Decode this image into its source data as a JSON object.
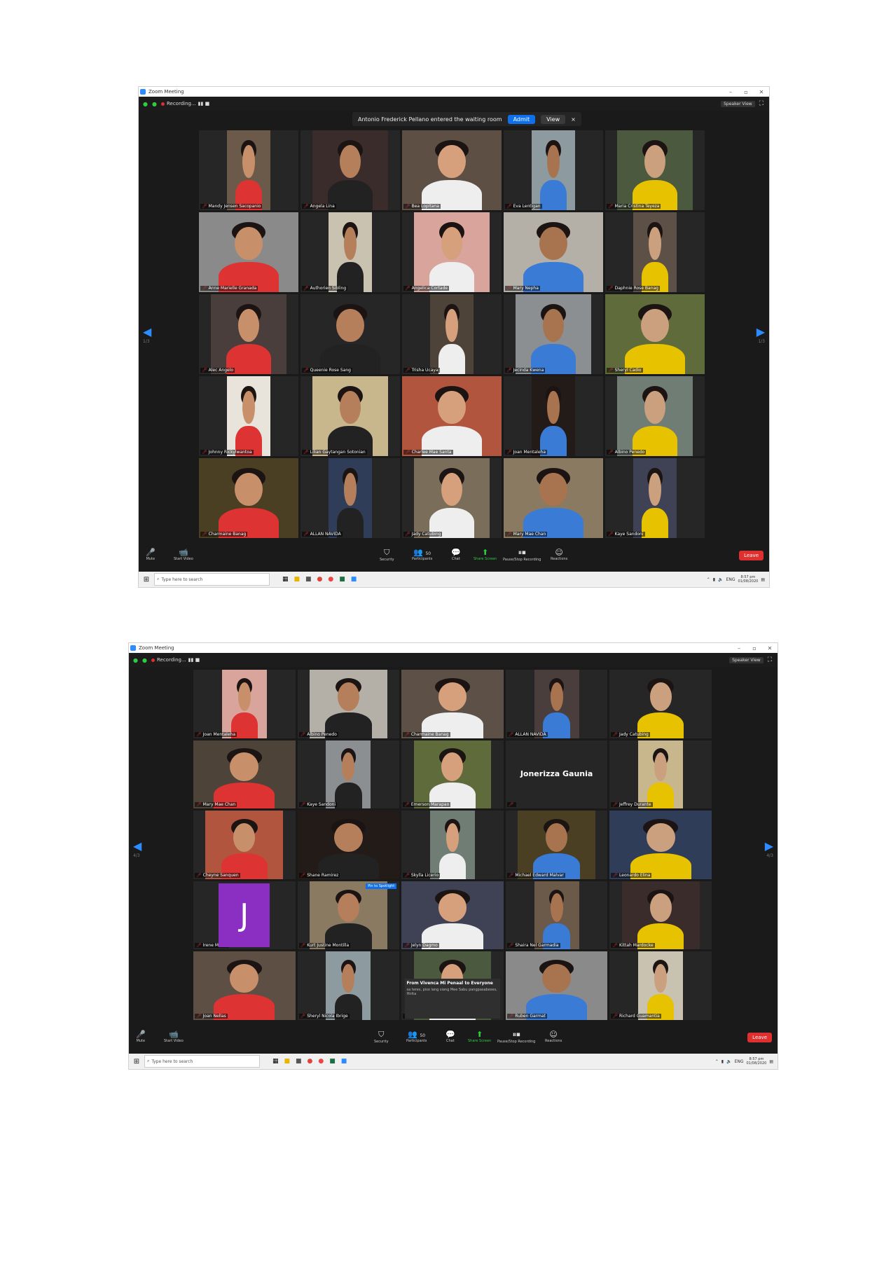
{
  "screens": [
    {
      "window_title": "Zoom Meeting",
      "recording_label": "Recording...",
      "notice": {
        "text": "Antonio Frederick Pellano entered the waiting room",
        "admit": "Admit",
        "view": "View",
        "close": "×"
      },
      "speaker_view": "Speaker View",
      "page_left": "1/3",
      "page_right": "1/3",
      "participants": [
        "Mandy Jensen Sacopanio",
        "Angela Lina",
        "Bea Lopitana",
        "Eva Lentigan",
        "Maria Cristina Teyeza",
        "Anne Marielle Granada",
        "Authorien Sibling",
        "Angelica Cortade",
        "Mary Nepha",
        "Daphnie Rose Banag",
        "Alec Angelo",
        "Queenie Rose Sang",
        "Trisha Ucaya",
        "Jecinda Kwena",
        "Sheryl Cadio",
        "Johnny Rickylwantoa",
        "Lilian Gaytangan Sotonian",
        "Charlee Mae Santa",
        "Joan Mentaleha",
        "Albino Penedo",
        "Charmaine Banag",
        "ALLAN NAVIDA",
        "Jady Catubing",
        "Mary Mae Chan",
        "Kaye Sandoni"
      ]
    },
    {
      "window_title": "Zoom Meeting",
      "recording_label": "Recording...",
      "speaker_view": "Speaker View",
      "page_left": "4/3",
      "page_right": "4/3",
      "participants": [
        "Joan Mentaleha",
        "Albino Penedo",
        "Charmaine Banag",
        "ALLAN NAVIDA",
        "Jady Catubing",
        "Mary Mae Chan",
        "Kaye Sandoni",
        "Emerson Marapao",
        "",
        "Jeffrey Durante",
        "Cheyne Sanquen",
        "Shane Ramirez",
        "Skylla Licerio",
        "Michael Edward Malvar",
        "Leonardo Elina",
        "Irene Mateo",
        "Kurt Justine Montilla",
        "Jelyn Dagmo",
        "Shaira Nel Garmadia",
        "Kittah Mardocke",
        "Joan Nellas",
        "Sheryl Nicola Ibrige",
        "",
        "Ruben Garmat",
        "Richard Guamantia"
      ],
      "big_name": "Jonerizza Gaunia",
      "avatar_letter": "J",
      "pin_label": "Pin to Spotlight",
      "chat": {
        "from": "From Vivenca Mi Penaal to Everyone",
        "message": "sa teres, piso lang siang Mee Sabu pangpasabeses, Hirita"
      }
    }
  ],
  "toolbar": {
    "mute": "Mute",
    "video": "Start Video",
    "security": "Security",
    "participants": "Participants",
    "participants_count": "50",
    "chat": "Chat",
    "share": "Share Screen",
    "record": "Pause/Stop Recording",
    "reactions": "Reactions",
    "leave": "Leave"
  },
  "taskbar": {
    "search_placeholder": "Type here to search",
    "lang": "ENG",
    "time": "8:57 pm",
    "date": "01/08/2020"
  }
}
